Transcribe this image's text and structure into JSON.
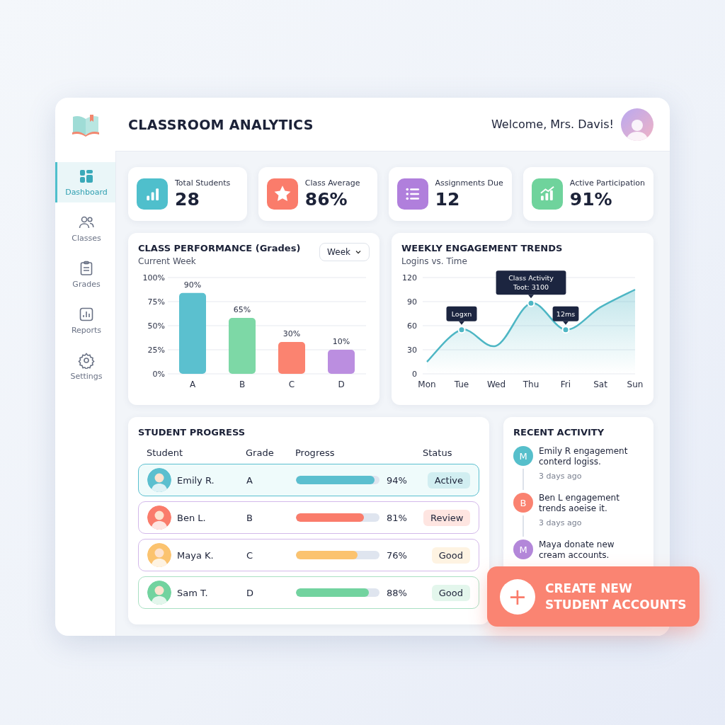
{
  "header": {
    "title": "CLASSROOM ANALYTICS",
    "welcome": "Welcome, Mrs. Davis!"
  },
  "sidebar": {
    "items": [
      {
        "label": "Dashboard",
        "selected": true
      },
      {
        "label": "Classes",
        "selected": false
      },
      {
        "label": "Grades",
        "selected": false
      },
      {
        "label": "Reports",
        "selected": false
      },
      {
        "label": "Settings",
        "selected": false
      }
    ]
  },
  "stats": [
    {
      "label": "Total Students",
      "value": "28",
      "color": "#4fbfcc"
    },
    {
      "label": "Class Average",
      "value": "86%",
      "color": "#fa7c6b"
    },
    {
      "label": "Assignments Due",
      "value": "12",
      "color": "#b07fdc"
    },
    {
      "label": "Active Participation",
      "value": "91%",
      "color": "#6fd39c"
    }
  ],
  "class_performance": {
    "title": "CLASS PERFORMANCE (Grades)",
    "subtitle": "Current Week",
    "dropdown": "Week",
    "chart_data": {
      "type": "bar",
      "grid": true,
      "categories": [
        "A",
        "B",
        "C",
        "D"
      ],
      "series": [
        {
          "color": "#5bc0cf",
          "values": [
            84,
            null,
            null,
            null
          ]
        },
        {
          "color": "#7dd8a6",
          "values": [
            null,
            58,
            null,
            null
          ]
        },
        {
          "color": "#fb8370",
          "values": [
            null,
            null,
            33,
            null
          ]
        },
        {
          "color": "#bb8ee0",
          "values": [
            null,
            null,
            null,
            25
          ]
        }
      ],
      "ylim": [
        0,
        100
      ],
      "yticks": [
        {
          "value": 0,
          "label": "0%"
        },
        {
          "value": 25,
          "label": "25%"
        },
        {
          "value": 50,
          "label": "50%"
        },
        {
          "value": 75,
          "label": "75%"
        },
        {
          "value": 100,
          "label": "100%"
        }
      ],
      "value_labels": [
        "90%",
        "65%",
        "30%",
        "10%"
      ]
    }
  },
  "weekly_engagement": {
    "title": "WEEKLY ENGAGEMENT TRENDS",
    "subtitle": "Logins vs. Time",
    "chart_data": {
      "type": "area",
      "grid": true,
      "categories": [
        "Mon",
        "Tue",
        "Wed",
        "Thu",
        "Fri",
        "Sat",
        "Sun"
      ],
      "series": [
        {
          "color": "#4db6c4",
          "values": [
            15,
            55,
            35,
            88,
            55,
            83,
            105
          ]
        }
      ],
      "ylim": [
        0,
        120
      ],
      "yticks": [
        0,
        30,
        60,
        90,
        120
      ],
      "annotations": [
        {
          "x": "Tue",
          "y": 55,
          "text": "Logxn"
        },
        {
          "x": "Thu",
          "y": 88,
          "text": "Class Activity\nToot: 3100"
        },
        {
          "x": "Fri",
          "y": 55,
          "text": "12ms"
        }
      ]
    }
  },
  "student_progress": {
    "title": "STUDENT PROGRESS",
    "columns": [
      "Student",
      "Grade",
      "Progress",
      "Status"
    ],
    "rows": [
      {
        "name": "Emily R.",
        "grade": "A",
        "level": 0.94,
        "percent": "94%",
        "status": "Active",
        "color": "#5bbfcf",
        "selected": true
      },
      {
        "name": "Ben L.",
        "grade": "B",
        "level": 0.81,
        "percent": "81%",
        "status": "Review",
        "color": "#fa7c6b",
        "selected": false
      },
      {
        "name": "Maya K.",
        "grade": "C",
        "level": 0.74,
        "percent": "76%",
        "status": "Good",
        "color": "#fbc36f",
        "selected": false
      },
      {
        "name": "Sam T.",
        "grade": "D",
        "level": 0.87,
        "percent": "88%",
        "status": "Good",
        "color": "#72d39f",
        "selected": false
      }
    ]
  },
  "recent_activity": {
    "title": "RECENT ACTIVITY",
    "items": [
      {
        "initial": "M",
        "color": "#56bfcb",
        "text": "Emily R engagement conterd logiss.",
        "time": "3 days ago"
      },
      {
        "initial": "B",
        "color": "#fa8270",
        "text": "Ben L engagement trends aoeise it.",
        "time": "3 days ago"
      },
      {
        "initial": "M",
        "color": "#b387d9",
        "text": "Maya donate new cream accounts."
      }
    ]
  },
  "create_button": {
    "icon": "+",
    "label": "CREATE NEW STUDENT ACCOUNTS"
  }
}
